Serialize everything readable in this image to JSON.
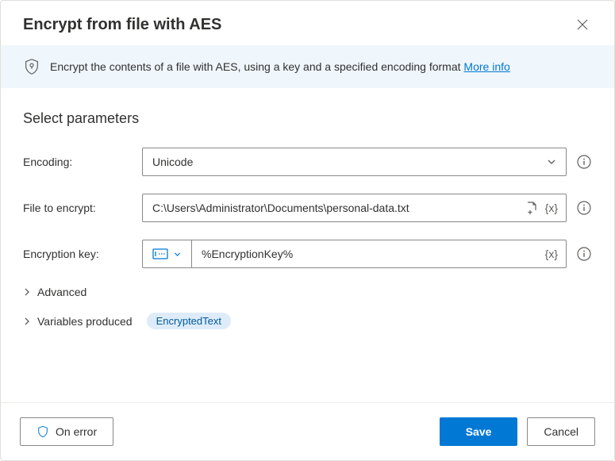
{
  "header": {
    "title": "Encrypt from file with AES"
  },
  "banner": {
    "text": "Encrypt the contents of a file with AES, using a key and a specified encoding format ",
    "link_text": "More info"
  },
  "section": {
    "title": "Select parameters"
  },
  "fields": {
    "encoding": {
      "label": "Encoding:",
      "value": "Unicode"
    },
    "file": {
      "label": "File to encrypt:",
      "value": "C:\\Users\\Administrator\\Documents\\personal-data.txt"
    },
    "key": {
      "label": "Encryption key:",
      "value": "%EncryptionKey%"
    }
  },
  "expanders": {
    "advanced": "Advanced",
    "variables_produced": "Variables produced",
    "variable_chip": "EncryptedText"
  },
  "footer": {
    "on_error": "On error",
    "save": "Save",
    "cancel": "Cancel"
  },
  "tokens": {
    "variable_token": "{x}"
  }
}
